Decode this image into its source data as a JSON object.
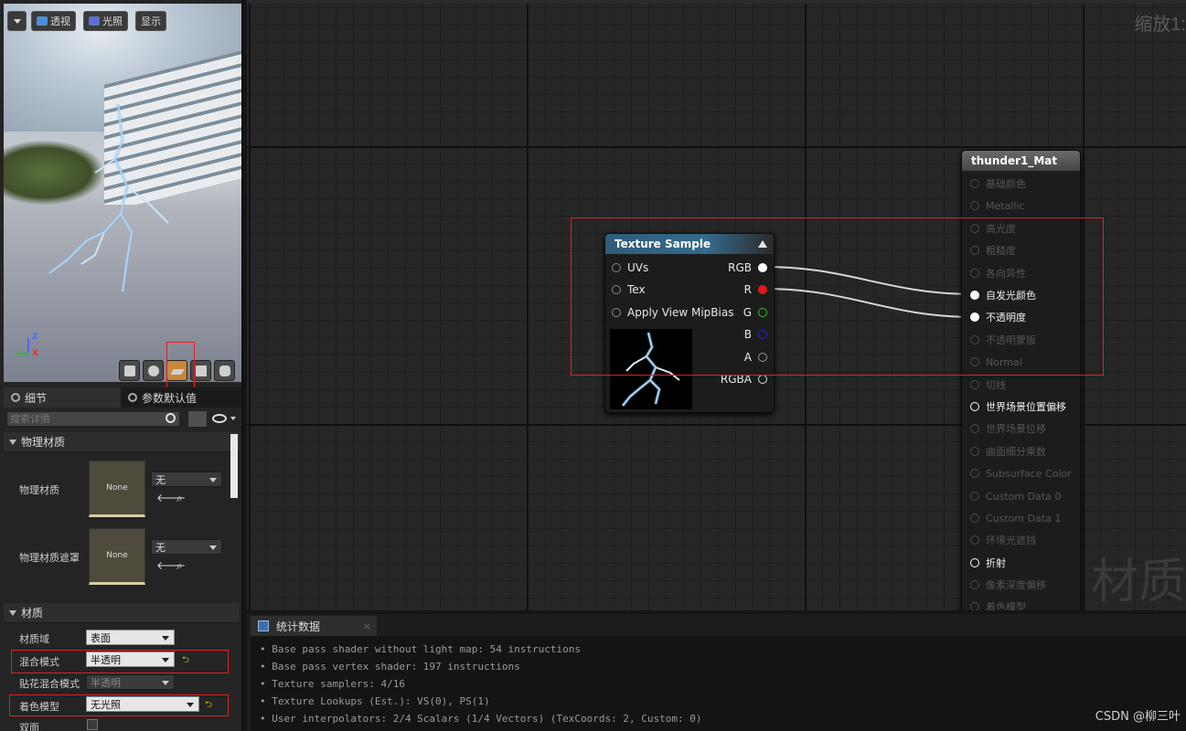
{
  "viewport": {
    "view_mode_label": "透视",
    "lighting_label": "光照",
    "show_label": "显示",
    "axis_z": "Z",
    "axis_x": "X"
  },
  "details": {
    "tab_details": "细节",
    "tab_params": "参数默认值",
    "search_placeholder": "搜索详情",
    "section_physical": "物理材质",
    "phys_mat_label": "物理材质",
    "phys_mat_thumb": "None",
    "phys_mat_value": "无",
    "phys_mask_label": "物理材质遮罩",
    "phys_mask_thumb": "None",
    "phys_mask_value": "无",
    "section_material": "材质",
    "domain_label": "材质域",
    "domain_value": "表面",
    "blend_label": "混合模式",
    "blend_value": "半透明",
    "decal_label": "贴花混合模式",
    "decal_value": "半透明",
    "shading_label": "着色模型",
    "shading_value": "无光照",
    "two_sided_label": "双面"
  },
  "graph": {
    "zoom_label": "缩放1:",
    "watermark": "材质",
    "texture_node": {
      "title": "Texture Sample",
      "inputs": [
        "UVs",
        "Tex",
        "Apply View MipBias"
      ],
      "outputs": [
        "RGB",
        "R",
        "G",
        "B",
        "A",
        "RGBA"
      ]
    },
    "material_node": {
      "title": "thunder1_Mat",
      "inputs": [
        "基础颜色",
        "Metallic",
        "高光度",
        "粗糙度",
        "各向异性",
        "自发光颜色",
        "不透明度",
        "不透明蒙版",
        "Normal",
        "切线",
        "世界场景位置偏移",
        "世界场景位移",
        "曲面细分乘数",
        "Subsurface Color",
        "Custom Data 0",
        "Custom Data 1",
        "环境光遮挡",
        "折射",
        "像素深度偏移",
        "着色模型"
      ]
    }
  },
  "stats": {
    "tab_label": "统计数据",
    "close": "×",
    "lines": [
      "• Base pass shader without light map: 54 instructions",
      "• Base pass vertex shader: 197 instructions",
      "• Texture samplers: 4/16",
      "• Texture Lookups (Est.): VS(0), PS(1)",
      "• User interpolators: 2/4 Scalars (1/4 Vectors) (TexCoords: 2, Custom: 0)"
    ],
    "credit": "CSDN @柳三叶"
  },
  "colors": {
    "highlight_box": "#e02020",
    "texture_header": "#2d5d7a",
    "pin_red": "#e01818",
    "pin_green": "#2ec02e",
    "pin_blue": "#2828d0"
  }
}
